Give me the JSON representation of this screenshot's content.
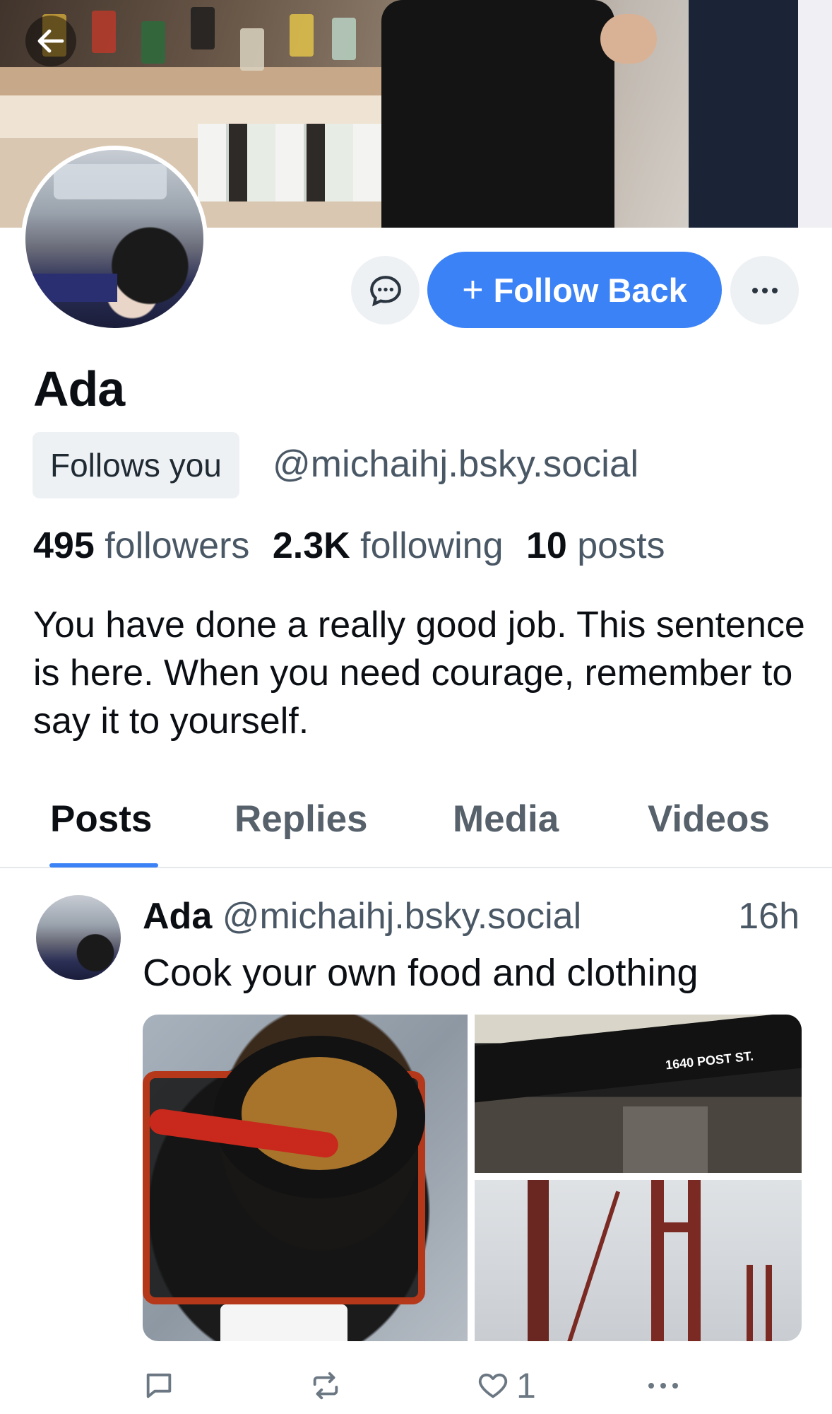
{
  "profile": {
    "display_name": "Ada",
    "follows_you_label": "Follows you",
    "handle": "@michaihj.bsky.social",
    "followers_count": "495",
    "followers_label": "followers",
    "following_count": "2.3K",
    "following_label": "following",
    "posts_count": "10",
    "posts_label": "posts",
    "bio": "You have done a really good job. This sentence is here. When you need courage, remember to say it to yourself."
  },
  "actions": {
    "follow_back_label": "Follow Back",
    "follow_back_icon": "plus-icon",
    "message_icon": "chat-bubble-icon",
    "more_icon": "ellipsis-icon",
    "back_icon": "arrow-left-icon"
  },
  "tabs": [
    {
      "label": "Posts",
      "active": true
    },
    {
      "label": "Replies",
      "active": false
    },
    {
      "label": "Media",
      "active": false
    },
    {
      "label": "Videos",
      "active": false
    }
  ],
  "post": {
    "author_name": "Ada",
    "author_handle": "@michaihj.bsky.social",
    "time": "16h",
    "text": "Cook your own food and clothing",
    "image_sign_text": "1640 POST ST.",
    "like_count": "1",
    "icons": [
      "reply-icon",
      "repost-icon",
      "heart-icon",
      "ellipsis-icon"
    ]
  },
  "colors": {
    "accent": "#3b82f6",
    "text": "#0b0f14",
    "muted": "#4a5866",
    "chip_bg": "#eef1f4"
  }
}
